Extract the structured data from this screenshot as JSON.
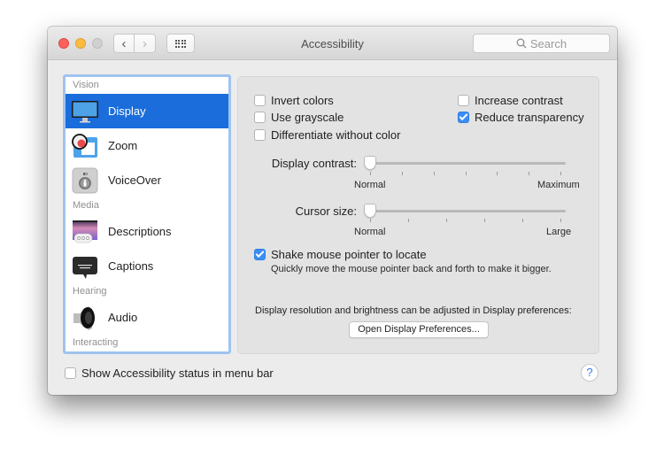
{
  "window": {
    "title": "Accessibility",
    "search_placeholder": "Search"
  },
  "icons": {
    "back": "‹",
    "forward": "›",
    "search": "⌕",
    "help": "?"
  },
  "sidebar": {
    "sections": [
      {
        "header": "Vision",
        "items": [
          {
            "label": "Display",
            "icon": "display-icon",
            "selected": true
          },
          {
            "label": "Zoom",
            "icon": "zoom-icon"
          },
          {
            "label": "VoiceOver",
            "icon": "voiceover-icon"
          }
        ]
      },
      {
        "header": "Media",
        "items": [
          {
            "label": "Descriptions",
            "icon": "descriptions-icon"
          },
          {
            "label": "Captions",
            "icon": "captions-icon"
          }
        ]
      },
      {
        "header": "Hearing",
        "items": [
          {
            "label": "Audio",
            "icon": "audio-icon"
          }
        ]
      },
      {
        "header": "Interacting",
        "items": []
      }
    ]
  },
  "display": {
    "checkboxes": {
      "invert_colors": {
        "label": "Invert colors",
        "checked": false
      },
      "use_grayscale": {
        "label": "Use grayscale",
        "checked": false
      },
      "differentiate": {
        "label": "Differentiate without color",
        "checked": false
      },
      "increase_contrast": {
        "label": "Increase contrast",
        "checked": false
      },
      "reduce_transparency": {
        "label": "Reduce transparency",
        "checked": true
      }
    },
    "display_contrast": {
      "label": "Display contrast:",
      "min_label": "Normal",
      "max_label": "Maximum",
      "value": 0,
      "tick_count": 7
    },
    "cursor_size": {
      "label": "Cursor size:",
      "min_label": "Normal",
      "max_label": "Large",
      "value": 0,
      "tick_count": 6
    },
    "shake_pointer": {
      "label": "Shake mouse pointer to locate",
      "hint": "Quickly move the mouse pointer back and forth to make it bigger.",
      "checked": true
    },
    "resolution_note": "Display resolution and brightness can be adjusted in Display preferences:",
    "open_display_prefs_label": "Open Display Preferences..."
  },
  "footer": {
    "show_status": {
      "label": "Show Accessibility status in menu bar",
      "checked": false
    }
  }
}
